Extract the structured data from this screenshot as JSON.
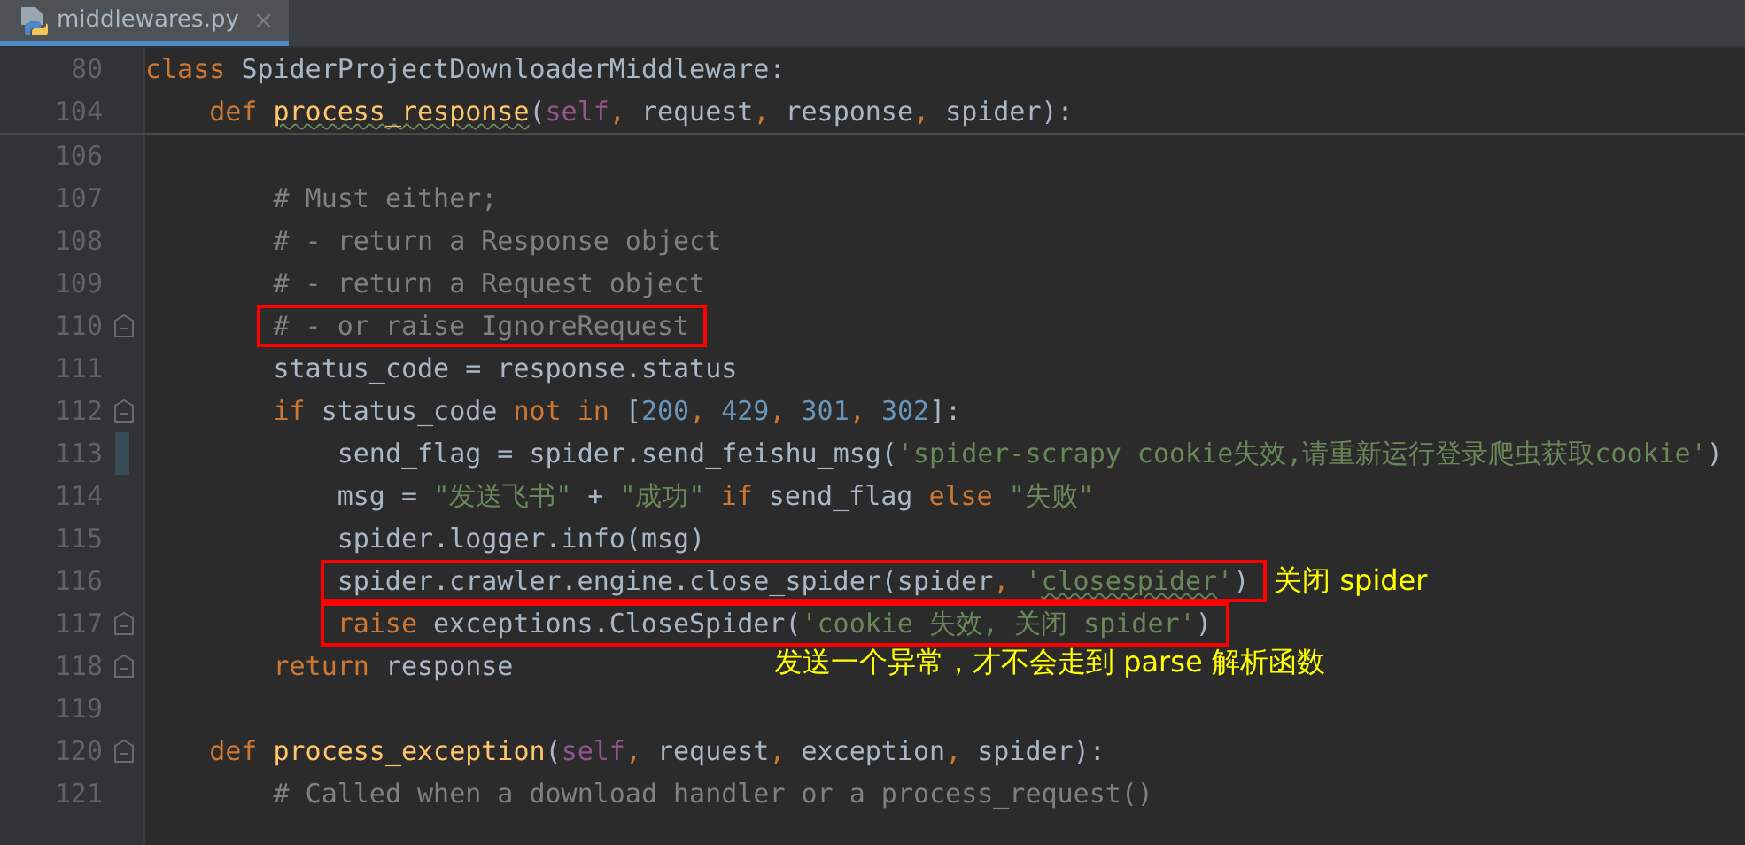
{
  "tab": {
    "label": "middlewares.py",
    "close": "×",
    "selected": true
  },
  "sticky_lines": [
    {
      "number": "80",
      "tokens": [
        {
          "text": "class ",
          "kind": "keyword"
        },
        {
          "text": "SpiderProjectDownloaderMiddleware:",
          "kind": "plain"
        }
      ]
    },
    {
      "number": "104",
      "tokens": [
        {
          "text": "    def ",
          "kind": "keyword"
        },
        {
          "text": "process_response",
          "kind": "function",
          "wavy": true
        },
        {
          "text": "(",
          "kind": "plain"
        },
        {
          "text": "self",
          "kind": "self"
        },
        {
          "text": ", ",
          "kind": "keyword"
        },
        {
          "text": "request",
          "kind": "plain"
        },
        {
          "text": ", ",
          "kind": "keyword"
        },
        {
          "text": "response",
          "kind": "plain"
        },
        {
          "text": ", ",
          "kind": "keyword"
        },
        {
          "text": "spider",
          "kind": "plain"
        },
        {
          "text": "):",
          "kind": "plain"
        }
      ]
    }
  ],
  "lines": [
    {
      "number": "106"
    },
    {
      "number": "107",
      "tokens": [
        {
          "text": "        # Must either;",
          "kind": "comment"
        }
      ]
    },
    {
      "number": "108",
      "tokens": [
        {
          "text": "        # - return a Response object",
          "kind": "comment"
        }
      ]
    },
    {
      "number": "109",
      "tokens": [
        {
          "text": "        # - return a Request object",
          "kind": "comment"
        }
      ]
    },
    {
      "number": "110",
      "fold": true,
      "boxed": true,
      "tokens": [
        {
          "text": "        # - or raise IgnoreRequest",
          "kind": "comment"
        }
      ]
    },
    {
      "number": "111",
      "tokens": [
        {
          "text": "        status_code = response.status",
          "kind": "plain"
        }
      ]
    },
    {
      "number": "112",
      "fold": true,
      "tokens": [
        {
          "text": "        if ",
          "kind": "keyword"
        },
        {
          "text": "status_code ",
          "kind": "plain"
        },
        {
          "text": "not in ",
          "kind": "keyword"
        },
        {
          "text": "[",
          "kind": "plain"
        },
        {
          "text": "200",
          "kind": "number"
        },
        {
          "text": ", ",
          "kind": "keyword"
        },
        {
          "text": "429",
          "kind": "number"
        },
        {
          "text": ", ",
          "kind": "keyword"
        },
        {
          "text": "301",
          "kind": "number"
        },
        {
          "text": ", ",
          "kind": "keyword"
        },
        {
          "text": "302",
          "kind": "number"
        },
        {
          "text": "]:",
          "kind": "plain"
        }
      ]
    },
    {
      "number": "113",
      "changed": true,
      "tokens": [
        {
          "text": "            send_flag = spider.send_feishu_msg(",
          "kind": "plain"
        },
        {
          "text": "'spider-scrapy cookie失效,请重新运行登录爬虫获取cookie'",
          "kind": "string"
        },
        {
          "text": ")",
          "kind": "plain"
        }
      ]
    },
    {
      "number": "114",
      "tokens": [
        {
          "text": "            msg = ",
          "kind": "plain"
        },
        {
          "text": "\"发送飞书\"",
          "kind": "string"
        },
        {
          "text": " + ",
          "kind": "plain"
        },
        {
          "text": "\"成功\" ",
          "kind": "string"
        },
        {
          "text": "if ",
          "kind": "keyword"
        },
        {
          "text": "send_flag ",
          "kind": "plain"
        },
        {
          "text": "else ",
          "kind": "keyword"
        },
        {
          "text": "\"失败\"",
          "kind": "string"
        }
      ]
    },
    {
      "number": "115",
      "tokens": [
        {
          "text": "            spider.logger.info(msg)",
          "kind": "plain"
        }
      ]
    },
    {
      "number": "116",
      "boxed": true,
      "note": "关闭 spider",
      "tokens": [
        {
          "text": "            spider.crawler.engine.close_spider(spider",
          "kind": "plain"
        },
        {
          "text": ", ",
          "kind": "keyword"
        },
        {
          "text": "'",
          "kind": "string"
        },
        {
          "text": "closespider",
          "kind": "string",
          "wavy": true
        },
        {
          "text": "'",
          "kind": "string"
        },
        {
          "text": ")",
          "kind": "plain"
        }
      ]
    },
    {
      "number": "117",
      "fold": true,
      "boxed": true,
      "note_below": "发送一个异常，才不会走到 parse 解析函数",
      "tokens": [
        {
          "text": "            raise ",
          "kind": "keyword"
        },
        {
          "text": "exceptions.CloseSpider(",
          "kind": "plain"
        },
        {
          "text": "'cookie 失效, 关闭 spider'",
          "kind": "string"
        },
        {
          "text": ")",
          "kind": "plain"
        }
      ]
    },
    {
      "number": "118",
      "fold": true,
      "tokens": [
        {
          "text": "        return ",
          "kind": "keyword"
        },
        {
          "text": "response",
          "kind": "plain"
        }
      ]
    },
    {
      "number": "119"
    },
    {
      "number": "120",
      "fold": true,
      "tokens": [
        {
          "text": "    def ",
          "kind": "keyword"
        },
        {
          "text": "process_exception",
          "kind": "function"
        },
        {
          "text": "(",
          "kind": "plain"
        },
        {
          "text": "self",
          "kind": "self"
        },
        {
          "text": ", ",
          "kind": "keyword"
        },
        {
          "text": "request",
          "kind": "plain"
        },
        {
          "text": ", ",
          "kind": "keyword"
        },
        {
          "text": "exception",
          "kind": "plain"
        },
        {
          "text": ", ",
          "kind": "keyword"
        },
        {
          "text": "spider",
          "kind": "plain"
        },
        {
          "text": "):",
          "kind": "plain"
        }
      ]
    },
    {
      "number": "121",
      "tokens": [
        {
          "text": "        # Called when a download handler or a process_request()",
          "kind": "comment"
        }
      ]
    }
  ]
}
